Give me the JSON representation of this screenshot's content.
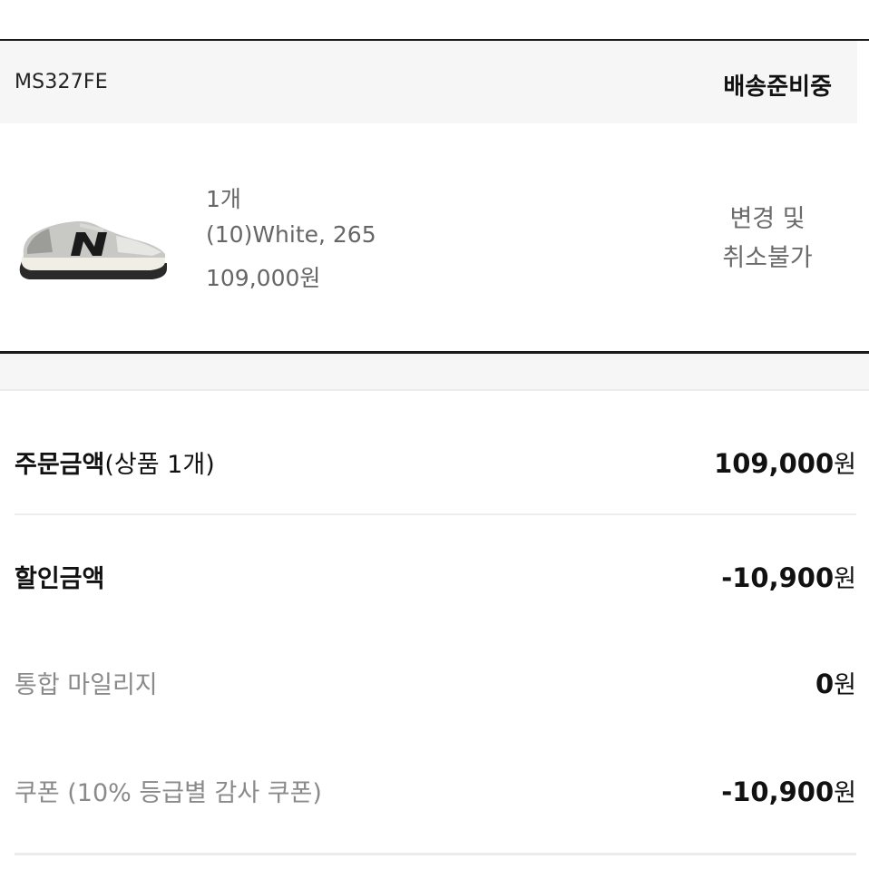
{
  "order": {
    "code": "MS327FE",
    "status": "배송준비중"
  },
  "item": {
    "qty": "1개",
    "option": "(10)White, 265",
    "price": "109,000원",
    "cancel_note_line1": "변경 및",
    "cancel_note_line2": "취소불가",
    "image_icon": "sneaker-product-image",
    "shoe_colors": {
      "upper": "#c8c8c4",
      "logo": "#1a1a1a",
      "sole": "#f1eee6",
      "outsole": "#2a2a2a"
    }
  },
  "summary": {
    "order_total_label": "주문금액",
    "order_total_sub": "(상품 1개)",
    "order_total_value": "109,000",
    "discount_label": "할인금액",
    "discount_value": "-10,900",
    "mileage_label": "통합 마일리지",
    "mileage_value": "0",
    "coupon_label": "쿠폰 (10% 등급별 감사 쿠폰)",
    "coupon_value": "-10,900",
    "currency_unit": "원"
  },
  "colors": {
    "discount_red": "#c8102e",
    "header_bg": "#f6f6f6",
    "muted_text": "#8a8a8a"
  }
}
